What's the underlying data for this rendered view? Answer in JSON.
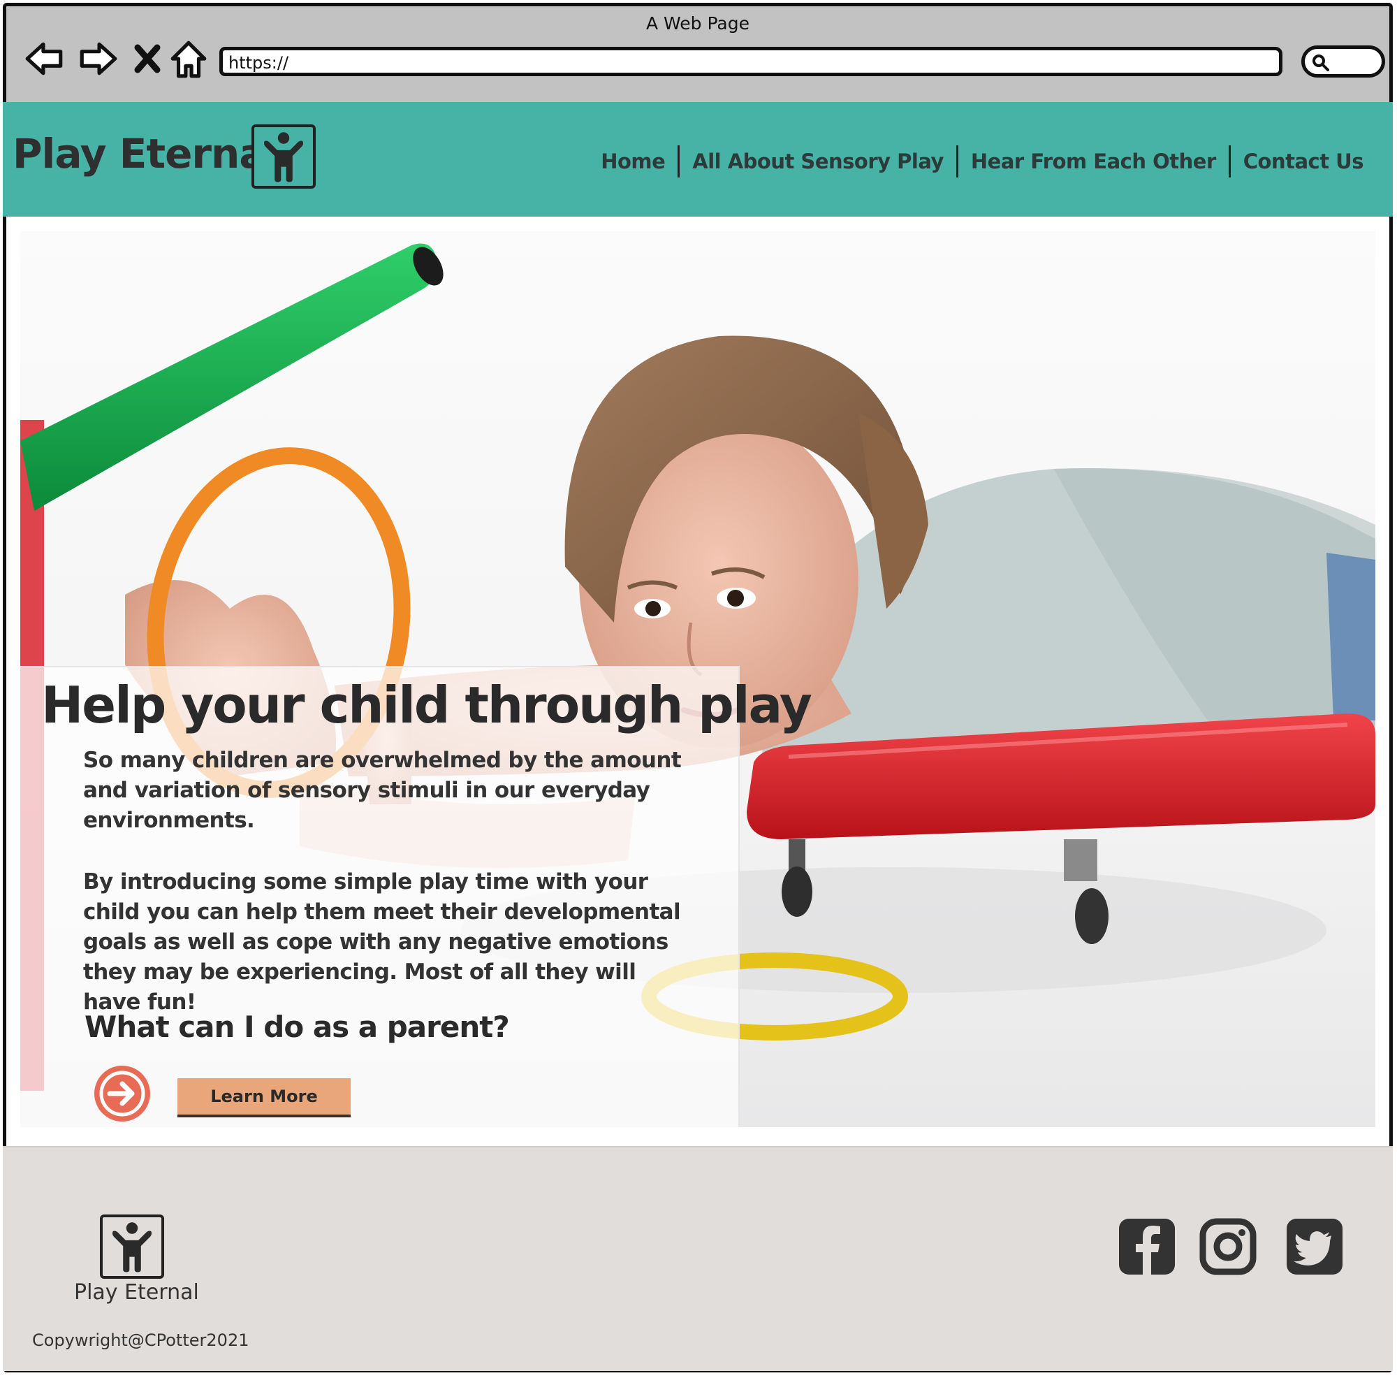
{
  "browser": {
    "window_title": "A Web Page",
    "address": "https://",
    "buttons": [
      "back-arrow-icon",
      "forward-arrow-icon",
      "close-x-icon",
      "home-icon"
    ]
  },
  "header": {
    "brand_name": "Play Eternal",
    "logo_icon": "child-figure-icon",
    "nav": [
      {
        "label": "Home"
      },
      {
        "label": "All About Sensory Play"
      },
      {
        "label": "Hear From Each Other"
      },
      {
        "label": "Contact Us"
      }
    ],
    "background_color": "#46b3a6"
  },
  "hero": {
    "title": "Help your child through play",
    "paragraph_1": "So many children are overwhelmed by the amount and variation of sensory stimuli in our everyday environments.",
    "paragraph_2": "By introducing some simple play time with your child you can help them meet their developmental goals as well as cope with any negative emotions they may be experiencing. Most of all they will have fun!",
    "question": "What can I do as a parent?",
    "cta_label": "Learn More",
    "cta_icon": "arrow-right-circle-icon",
    "cta_color": "#e8a67a",
    "arrow_color": "#e76b55"
  },
  "footer": {
    "brand_name": "Play Eternal",
    "copyright": "Copywright@CPotter2021",
    "social": [
      "facebook-icon",
      "instagram-icon",
      "twitter-icon"
    ],
    "background_color": "#e0dddb"
  }
}
